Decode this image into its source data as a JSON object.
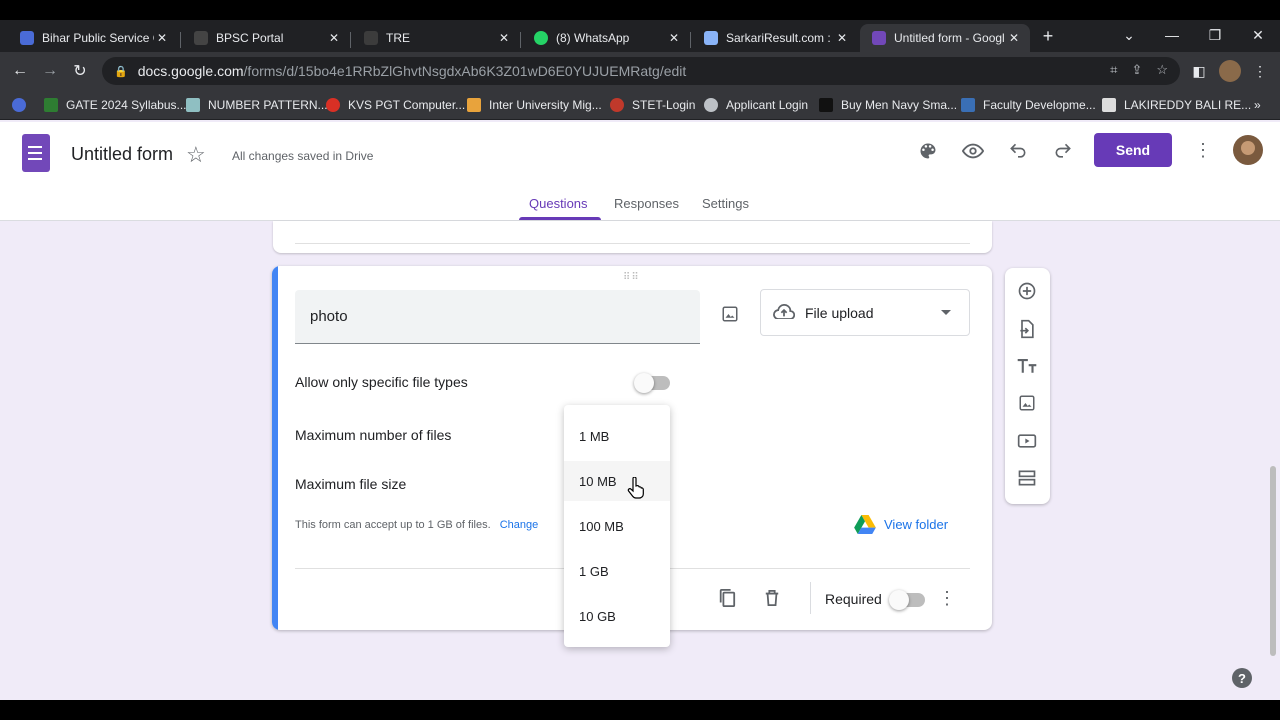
{
  "browser": {
    "tabs": [
      {
        "title": "Bihar Public Service Co",
        "color": "#4a6bd6"
      },
      {
        "title": "BPSC Portal",
        "color": "#444444"
      },
      {
        "title": "TRE",
        "color": "#3c3c3c"
      },
      {
        "title": "(8) WhatsApp",
        "color": "#25d366"
      },
      {
        "title": "SarkariResult.com : Sa",
        "color": "#8ab4f8"
      },
      {
        "title": "Untitled form - Googl",
        "color": "#7248b9"
      }
    ],
    "url_host": "docs.google.com",
    "url_path": "/forms/d/15bo4e1RRbZlGhvtNsgdxAb6K3Z01wD6E0YUJUEMRatg/edit",
    "bookmarks": [
      {
        "label": "GATE 2024 Syllabus...",
        "color": "#2e7d32"
      },
      {
        "label": "NUMBER PATTERN...",
        "color": "#8fbfc2"
      },
      {
        "label": "KVS PGT Computer...",
        "color": "#d93025"
      },
      {
        "label": "Inter University Mig...",
        "color": "#e8a33c"
      },
      {
        "label": "STET-Login",
        "color": "#c0392b"
      },
      {
        "label": "Applicant Login",
        "color": "#bdc1c6"
      },
      {
        "label": "Buy Men Navy Sma...",
        "color": "#000000"
      },
      {
        "label": "Faculty Developme...",
        "color": "#3a6fb5"
      },
      {
        "label": "LAKIREDDY BALI RE...",
        "color": "#dddddd"
      }
    ]
  },
  "form": {
    "title": "Untitled form",
    "saved_status": "All changes saved in Drive",
    "send_label": "Send",
    "tabs": [
      "Questions",
      "Responses",
      "Settings"
    ],
    "accent": "#673ab7"
  },
  "question": {
    "title": "photo",
    "type": "File upload",
    "allow_specific_label": "Allow only specific file types",
    "max_files_label": "Maximum number of files",
    "max_size_label": "Maximum file size",
    "limit_text": "This form can accept up to 1 GB of files.",
    "change_label": "Change",
    "view_folder_label": "View folder",
    "required_label": "Required"
  },
  "dropdown": {
    "options": [
      "1 MB",
      "10 MB",
      "100 MB",
      "1 GB",
      "10 GB"
    ],
    "hovered": "10 MB"
  }
}
